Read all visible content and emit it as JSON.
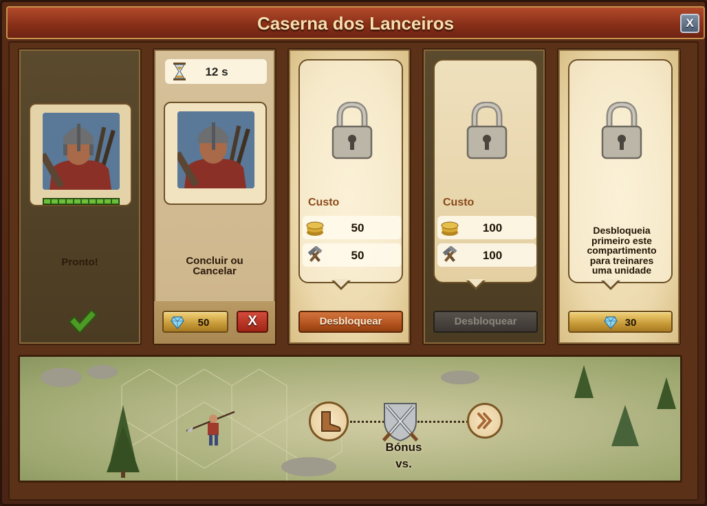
{
  "window": {
    "title": "Caserna dos Lanceiros",
    "close_label": "X"
  },
  "slots": [
    {
      "state": "ready",
      "status_text": "Pronto!",
      "progress_segments": 10,
      "icon": "checkmark-icon"
    },
    {
      "state": "training",
      "timer": "12 s",
      "status_text_line1": "Concluir ou",
      "status_text_line2": "Cancelar",
      "finish_cost": "50",
      "cancel_label": "X"
    },
    {
      "state": "locked",
      "cost_label": "Custo",
      "coins": "50",
      "supplies": "50",
      "button_label": "Desbloquear",
      "button_enabled": true
    },
    {
      "state": "locked",
      "cost_label": "Custo",
      "coins": "100",
      "supplies": "100",
      "button_label": "Desbloquear",
      "button_enabled": false
    },
    {
      "state": "locked-requires-previous",
      "info_lines": [
        "Desbloqueia",
        "primeiro este",
        "compartimento",
        "para treinares",
        "uma unidade"
      ],
      "diamond_cost": "30"
    }
  ],
  "battle": {
    "bonus_label": "Bónus",
    "vs_label": "vs.",
    "icons": [
      "boot-icon",
      "crossed-swords-shield-icon",
      "double-chevron-right-icon"
    ]
  },
  "colors": {
    "title_bar": "#8a3019",
    "title_text": "#f6dfad",
    "unlock_button": "#b4531f",
    "cancel_button": "#a02416",
    "gold_button": "#c79a38",
    "progress_fill": "#6cbf3b"
  }
}
